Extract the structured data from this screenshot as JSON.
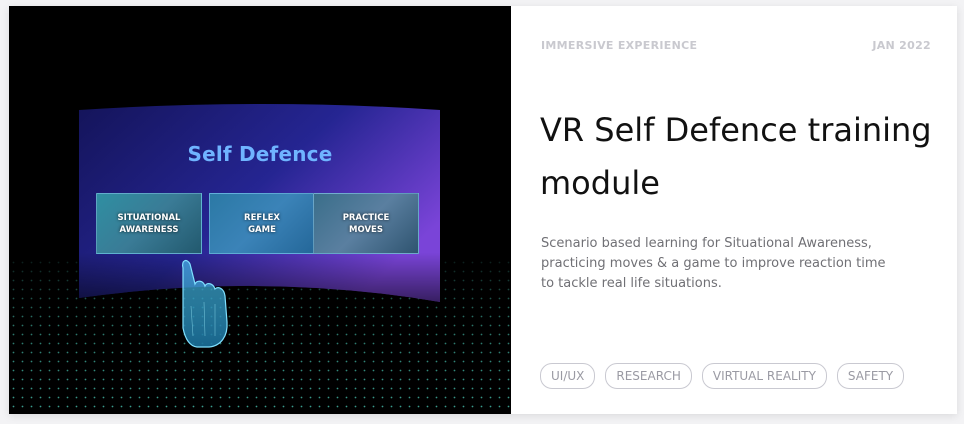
{
  "hero": {
    "screen_title": "Self Defence",
    "tiles": [
      {
        "label": "SITUATIONAL\nAWARENESS"
      },
      {
        "label": "REFLEX\nGAME"
      },
      {
        "label": "PRACTICE\nMOVES"
      }
    ]
  },
  "card": {
    "category": "IMMERSIVE EXPERIENCE",
    "date": "JAN 2022",
    "title": "VR Self Defence training module",
    "description": "Scenario based learning for Situational Awareness, practicing moves & a game to improve reaction time to tackle real life situations.",
    "tags": [
      "UI/UX",
      "RESEARCH",
      "VIRTUAL REALITY",
      "SAFETY"
    ]
  },
  "colors": {
    "hero_background": "#000000",
    "screen_gradient_start": "#1a1a6e",
    "screen_gradient_end": "#6a3bd0",
    "hero_title": "#6fb4ff",
    "hand_glow": "#7fe0ff",
    "text_primary": "#111111",
    "text_secondary": "#707075",
    "meta_text": "#c9c9cf"
  },
  "icons": {
    "hand": "pointing-hand-icon"
  }
}
